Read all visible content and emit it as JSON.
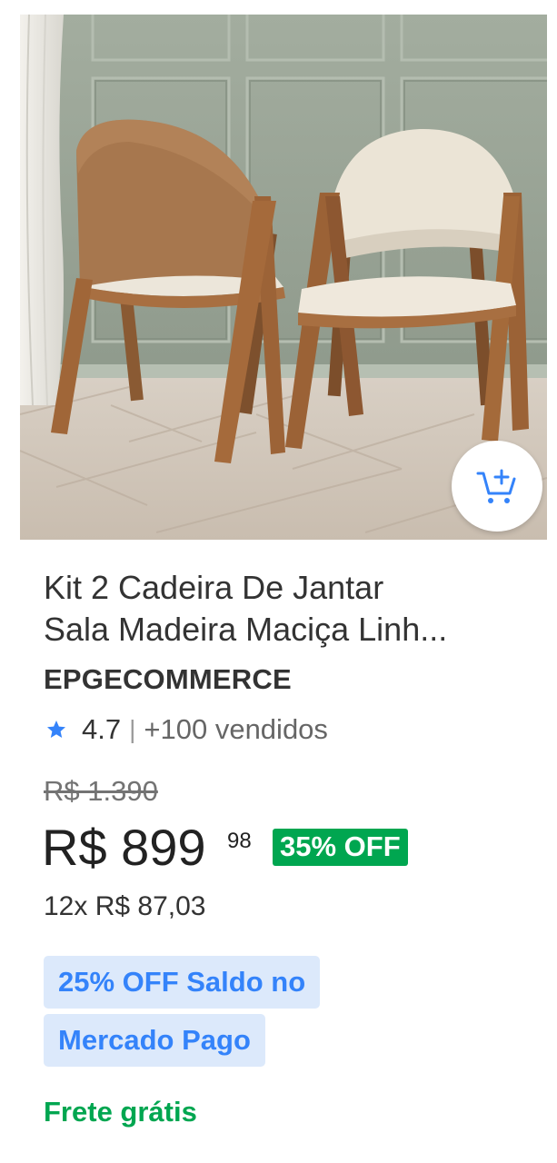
{
  "product": {
    "image_alt": "product-photo-two-dining-chairs",
    "title_line1": "Kit 2 Cadeira De Jantar",
    "title_line2": "Sala Madeira Maciça Linh...",
    "seller": "EPGECOMMERCE",
    "rating": "4.7",
    "rating_separator": "|",
    "sold": "+100 vendidos",
    "old_price": "R$ 1.390",
    "price_main": "R$ 899",
    "price_cents": "98",
    "discount": "35% OFF",
    "installments": "12x R$ 87,03",
    "promo_line1": "25% OFF Saldo no",
    "promo_line2": "Mercado Pago",
    "shipping": "Frete grátis"
  },
  "icons": {
    "cart": "add-to-cart-icon",
    "star": "star-icon"
  },
  "colors": {
    "accent_blue": "#3483fa",
    "promo_bg": "#dce9fb",
    "green": "#00a650",
    "text": "#333333"
  }
}
